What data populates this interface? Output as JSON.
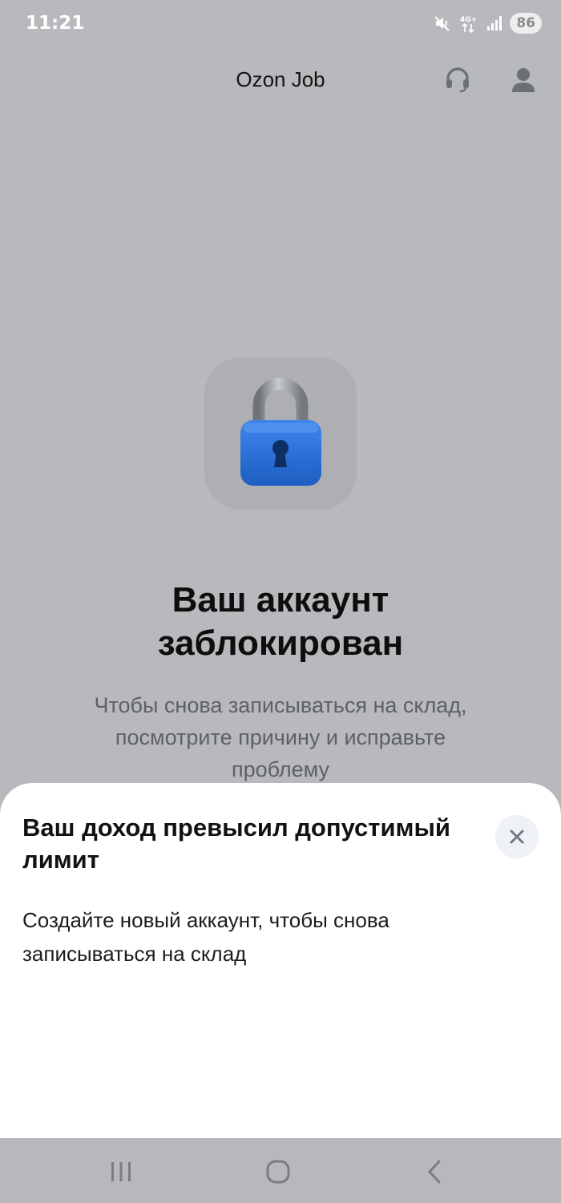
{
  "status_bar": {
    "time": "11:21",
    "network": "4G+",
    "battery": "86",
    "icons": [
      "mute-icon",
      "network-4g-icon",
      "signal-icon",
      "battery-icon"
    ]
  },
  "top_bar": {
    "title": "Ozon Job",
    "support_icon": "headset-icon",
    "profile_icon": "user-icon"
  },
  "blocked": {
    "icon": "padlock-icon",
    "title": "Ваш аккаунт заблокирован",
    "description": "Чтобы снова записываться на склад, посмотрите причину и исправьте проблему"
  },
  "sheet": {
    "title": "Ваш доход превысил допустимый лимит",
    "text": "Создайте новый аккаунт, чтобы снова записываться на склад",
    "close_icon": "close-icon"
  },
  "nav_bar": {
    "icons": [
      "recent-apps-icon",
      "home-icon",
      "back-icon"
    ]
  },
  "colors": {
    "overlay": "#b8b9bc",
    "lock_blue": "#2a6fd6",
    "sheet_bg": "#ffffff",
    "title_text": "#0e0e0e",
    "muted_text": "#5d6066"
  }
}
